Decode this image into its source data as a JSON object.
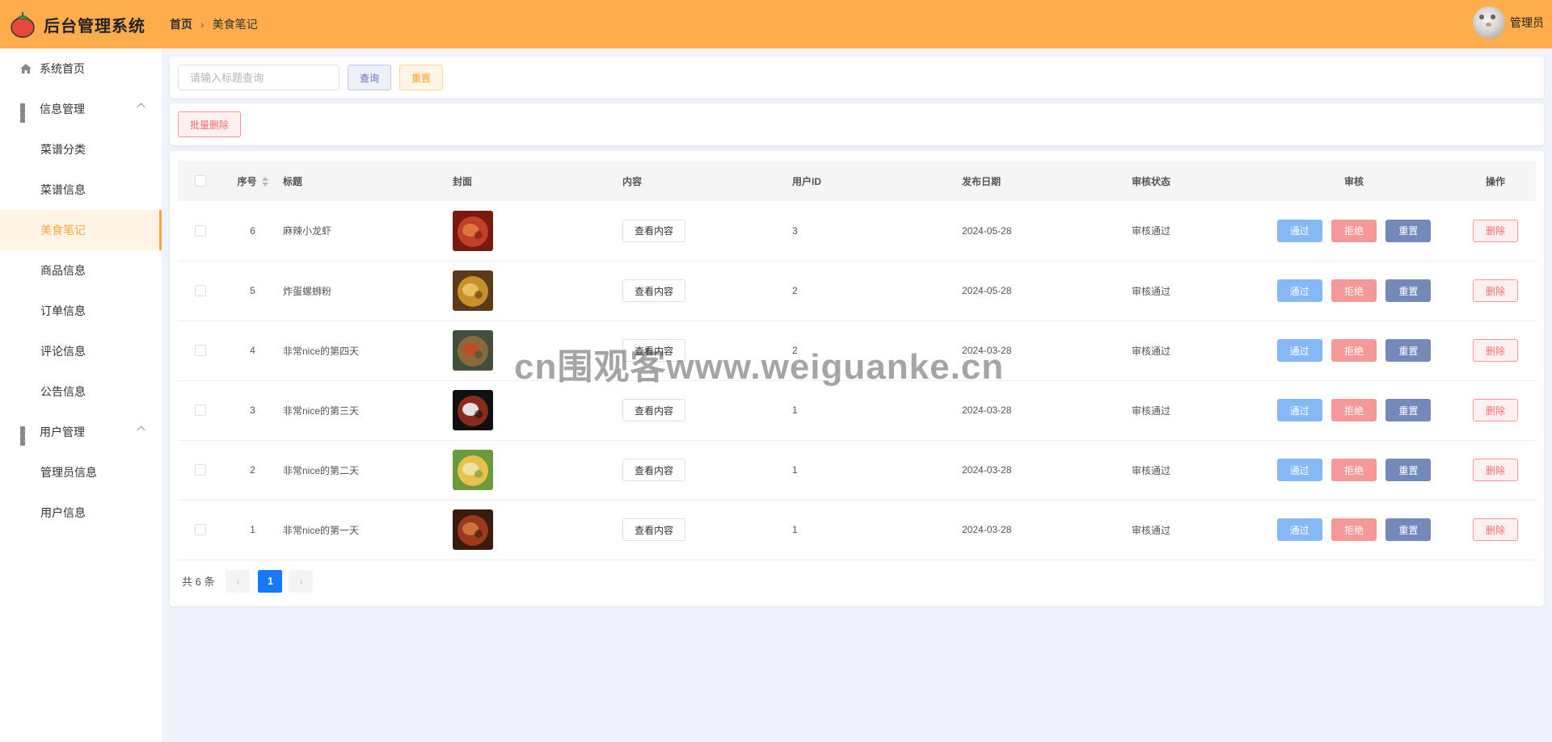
{
  "header": {
    "app_title": "后台管理系统",
    "breadcrumb": {
      "home": "首页",
      "current": "美食笔记"
    },
    "user_name": "管理员"
  },
  "sidebar": {
    "items": [
      {
        "label": "系统首页",
        "icon": "home-icon",
        "type": "top"
      },
      {
        "label": "信息管理",
        "icon": "grid-icon",
        "type": "group",
        "expanded": true
      },
      {
        "label": "菜谱分类",
        "type": "sub"
      },
      {
        "label": "菜谱信息",
        "type": "sub"
      },
      {
        "label": "美食笔记",
        "type": "sub",
        "active": true
      },
      {
        "label": "商品信息",
        "type": "sub"
      },
      {
        "label": "订单信息",
        "type": "sub"
      },
      {
        "label": "评论信息",
        "type": "sub"
      },
      {
        "label": "公告信息",
        "type": "sub"
      },
      {
        "label": "用户管理",
        "icon": "grid-icon",
        "type": "group",
        "expanded": true
      },
      {
        "label": "管理员信息",
        "type": "sub"
      },
      {
        "label": "用户信息",
        "type": "sub"
      }
    ]
  },
  "search": {
    "placeholder": "请输入标题查询",
    "value": "",
    "query_label": "查询",
    "reset_label": "重置"
  },
  "toolbar": {
    "batch_delete_label": "批量删除"
  },
  "table": {
    "columns": [
      "序号",
      "标题",
      "封面",
      "内容",
      "用户ID",
      "发布日期",
      "审核状态",
      "审核",
      "操作"
    ],
    "view_content_label": "查看内容",
    "pass_label": "通过",
    "reject_label": "拒绝",
    "reset_label": "重置",
    "delete_label": "删除",
    "rows": [
      {
        "id": "6",
        "title": "麻辣小龙虾",
        "user_id": "3",
        "date": "2024-05-28",
        "status": "审核通过",
        "cover_colors": [
          "#7a1a0e",
          "#c0402a",
          "#e0743a"
        ]
      },
      {
        "id": "5",
        "title": "炸蛋螺蛳粉",
        "user_id": "2",
        "date": "2024-05-28",
        "status": "审核通过",
        "cover_colors": [
          "#5a3a1a",
          "#c8902a",
          "#e8c060"
        ]
      },
      {
        "id": "4",
        "title": "非常nice的第四天",
        "user_id": "2",
        "date": "2024-03-28",
        "status": "审核通过",
        "cover_colors": [
          "#40503a",
          "#8a6a3a",
          "#c04a2a"
        ]
      },
      {
        "id": "3",
        "title": "非常nice的第三天",
        "user_id": "1",
        "date": "2024-03-28",
        "status": "审核通过",
        "cover_colors": [
          "#101010",
          "#8a2a1a",
          "#e0e0e0"
        ]
      },
      {
        "id": "2",
        "title": "非常nice的第二天",
        "user_id": "1",
        "date": "2024-03-28",
        "status": "审核通过",
        "cover_colors": [
          "#6a9a3a",
          "#e8c050",
          "#f0e0a0"
        ]
      },
      {
        "id": "1",
        "title": "非常nice的第一天",
        "user_id": "1",
        "date": "2024-03-28",
        "status": "审核通过",
        "cover_colors": [
          "#3a1a0a",
          "#9a3a1a",
          "#d0703a"
        ]
      }
    ]
  },
  "pagination": {
    "total_text": "共 6 条",
    "current_page": "1",
    "prev_icon": "chevron-left-icon",
    "next_icon": "chevron-right-icon"
  },
  "watermark": "cn围观客www.weiguanke.cn",
  "colors": {
    "header_bg": "#ffad4c",
    "accent": "#ffa53e",
    "page_bg": "#f1f3fa"
  }
}
